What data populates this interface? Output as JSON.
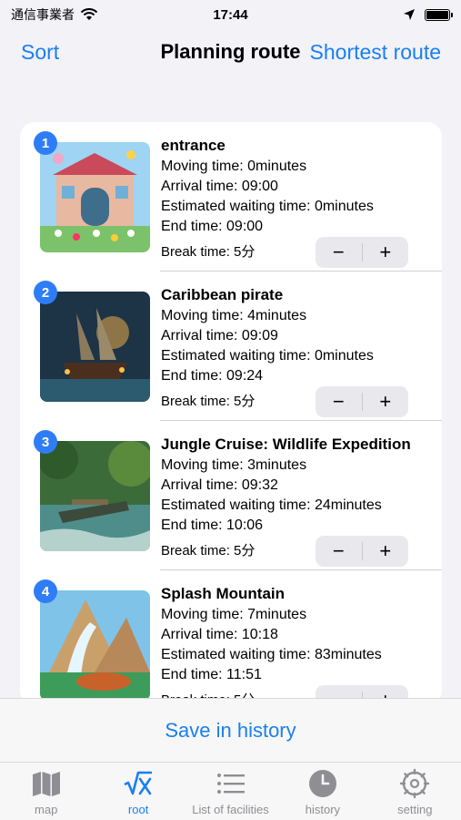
{
  "status_bar": {
    "carrier": "通信事業者",
    "time": "17:44"
  },
  "nav": {
    "left": "Sort",
    "title": "Planning route",
    "right": "Shortest route"
  },
  "labels": {
    "moving": "Moving time: ",
    "arrival": "Arrival time: ",
    "waiting": "Estimated waiting time: ",
    "end": "End time: ",
    "break": "Break time: "
  },
  "items": [
    {
      "index": "1",
      "title": "entrance",
      "moving": "0minutes",
      "arrival": "09:00",
      "waiting": "0minutes",
      "end": "09:00",
      "break": "5分"
    },
    {
      "index": "2",
      "title": "Caribbean pirate",
      "moving": "4minutes",
      "arrival": "09:09",
      "waiting": "0minutes",
      "end": "09:24",
      "break": "5分"
    },
    {
      "index": "3",
      "title": "Jungle Cruise: Wildlife Expedition",
      "moving": "3minutes",
      "arrival": "09:32",
      "waiting": "24minutes",
      "end": "10:06",
      "break": "5分"
    },
    {
      "index": "4",
      "title": "Splash Mountain",
      "moving": "7minutes",
      "arrival": "10:18",
      "waiting": "83minutes",
      "end": "11:51",
      "break": "5分"
    }
  ],
  "stepper": {
    "minus": "−",
    "plus": "+"
  },
  "save_button": "Save in history",
  "tabs": [
    {
      "label": "map",
      "icon": "map-icon"
    },
    {
      "label": "root",
      "icon": "sqrt-x-icon"
    },
    {
      "label": "List of facilities",
      "icon": "list-icon"
    },
    {
      "label": "history",
      "icon": "clock-icon"
    },
    {
      "label": "setting",
      "icon": "gear-icon"
    }
  ],
  "colors": {
    "accent": "#1a7ff0",
    "badge": "#2f7df6",
    "inactive_tab": "#8e8e93"
  }
}
